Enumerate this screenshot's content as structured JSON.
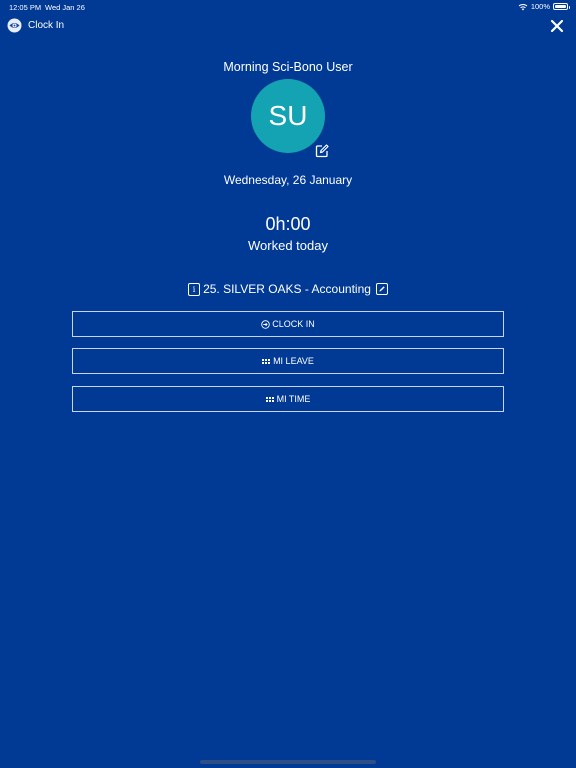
{
  "status_bar": {
    "time": "12:05 PM",
    "date": "Wed Jan 26",
    "battery": "100%"
  },
  "nav": {
    "title": "Clock In",
    "close_icon": "close-icon",
    "app_icon": "eye-icon"
  },
  "profile": {
    "name": "Morning Sci-Bono User",
    "initials": "SU",
    "avatar_color": "#14a3b3",
    "date": "Wednesday, 26 January"
  },
  "worked": {
    "time": "0h:00",
    "label": "Worked today"
  },
  "project": {
    "info_glyph": "i",
    "label": "25. SILVER OAKS - Accounting"
  },
  "actions": {
    "clock_in": "CLOCK IN",
    "mi_leave": "MI LEAVE",
    "mi_time": "MI TIME"
  },
  "colors": {
    "background": "#003a94",
    "button_border": "#c9d4ea"
  }
}
